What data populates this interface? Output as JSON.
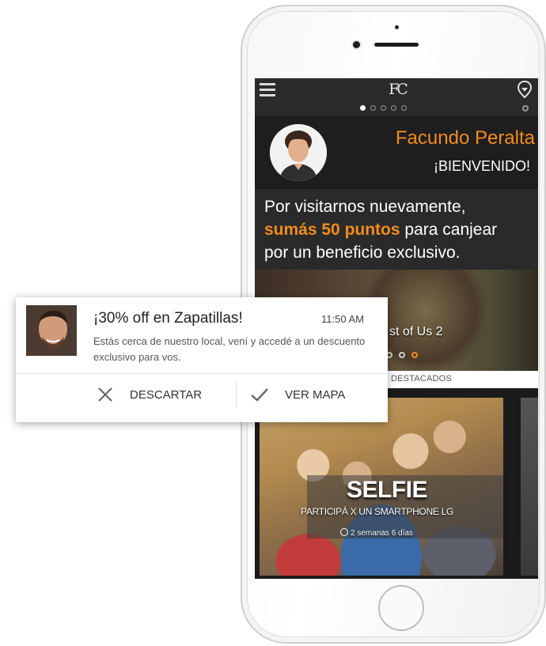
{
  "app": {
    "logo": "FC",
    "pager_count": 5,
    "active_page": 1
  },
  "welcome": {
    "user_name": "Facundo Peralta",
    "greeting": "¡BIENVENIDO!"
  },
  "promo": {
    "line1": "Por visitarnos nuevamente,",
    "highlight": "sumás 50 puntos",
    "line2_rest": " para canjear",
    "line3": "por un beneficio exclusivo."
  },
  "banner": {
    "title": "st of Us 2"
  },
  "tabs": {
    "featured": "DESTACADOS"
  },
  "card": {
    "title": "SELFIE",
    "subtitle": "PARTICIPÁ X UN SMARTPHONE LG",
    "duration": "2 semanas 6 días"
  },
  "notification": {
    "title": "¡30% off en Zapatillas!",
    "time": "11:50 AM",
    "body": "Estás cerca de nuestro local, vení y accedé a un descuento exclusivo para vos.",
    "dismiss_label": "DESCARTAR",
    "map_label": "VER MAPA"
  },
  "colors": {
    "accent": "#f28b1e",
    "screen_bg": "#1b1b1b"
  }
}
